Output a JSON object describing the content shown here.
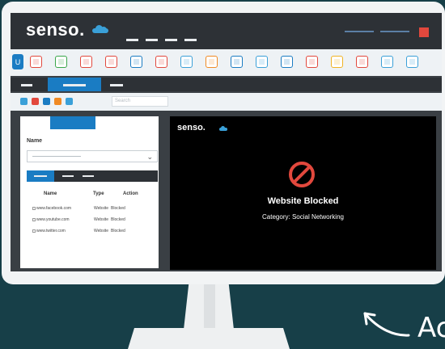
{
  "app": {
    "logo": "senso.",
    "brand_color": "#1a7cc3",
    "cloud_color": "#3aa0d8",
    "close_color": "#e2483d"
  },
  "toolbar": {
    "first_icon_label": "U",
    "icons": [
      {
        "name": "app-icon-1",
        "color": "#e2483d"
      },
      {
        "name": "app-icon-2",
        "color": "#3aa64a"
      },
      {
        "name": "app-icon-3",
        "color": "#e2483d"
      },
      {
        "name": "app-icon-4",
        "color": "#e2483d"
      },
      {
        "name": "app-icon-5",
        "color": "#1a7cc3"
      },
      {
        "name": "app-icon-6",
        "color": "#e2483d"
      },
      {
        "name": "app-icon-7",
        "color": "#3aa0d8"
      },
      {
        "name": "app-icon-8",
        "color": "#f08a24"
      },
      {
        "name": "app-icon-9",
        "color": "#1a7cc3"
      },
      {
        "name": "app-icon-10",
        "color": "#3aa0d8"
      },
      {
        "name": "app-icon-11",
        "color": "#1a7cc3"
      },
      {
        "name": "app-icon-12",
        "color": "#e2483d"
      },
      {
        "name": "app-icon-13",
        "color": "#f0b323"
      },
      {
        "name": "app-icon-14",
        "color": "#e2483d"
      },
      {
        "name": "app-icon-15",
        "color": "#3aa0d8"
      },
      {
        "name": "app-icon-16",
        "color": "#3aa0d8"
      }
    ]
  },
  "subbar": {
    "icon_colors": [
      "#3aa0d8",
      "#e2483d",
      "#1a7cc3",
      "#f08a24",
      "#3aa0d8"
    ],
    "search_placeholder": "Search"
  },
  "sidepanel": {
    "select_label": "Name",
    "columns": [
      "Name",
      "Type",
      "Action"
    ],
    "rows": [
      {
        "name": "www.facebook.com",
        "type": "Website",
        "action": "Blocked"
      },
      {
        "name": "www.youtube.com",
        "type": "Website",
        "action": "Blocked"
      },
      {
        "name": "www.twitter.com",
        "type": "Website",
        "action": "Blocked"
      }
    ]
  },
  "content": {
    "logo": "senso.",
    "title": "Website Blocked",
    "subtitle": "Category: Social Networking"
  },
  "annotation": {
    "text": "Ac"
  }
}
